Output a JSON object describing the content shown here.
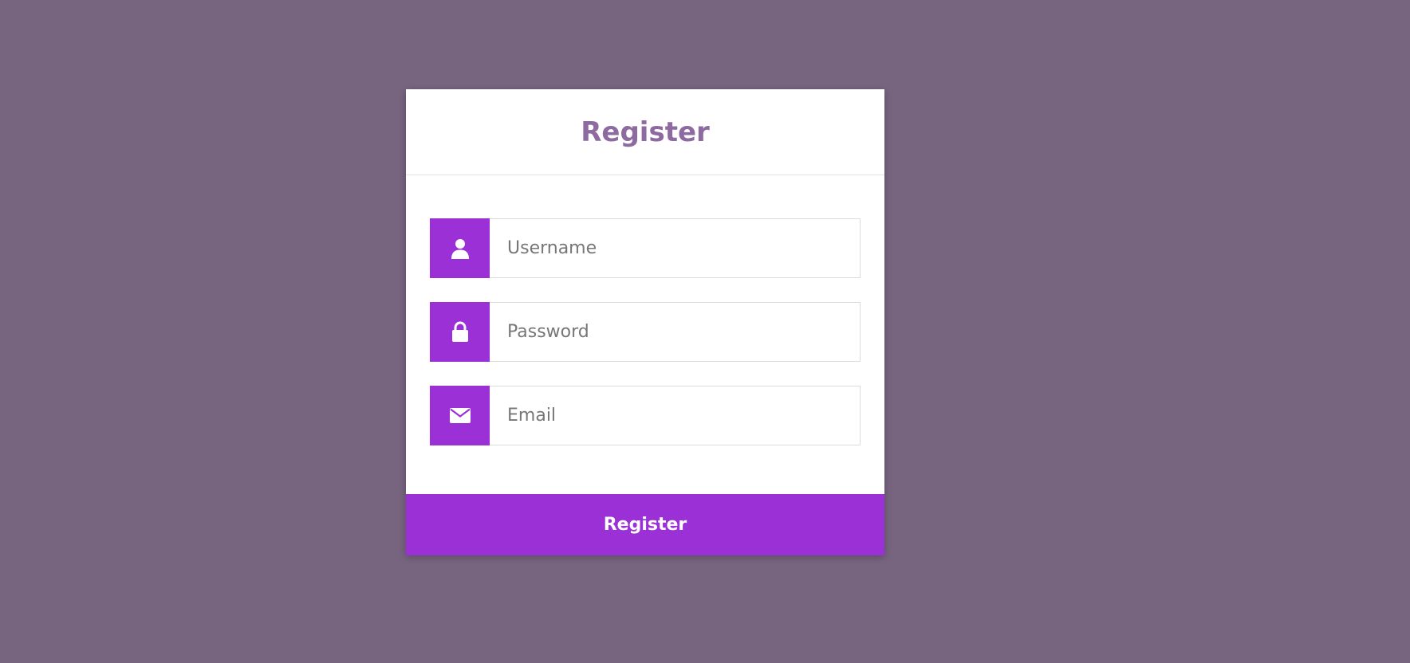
{
  "form": {
    "title": "Register",
    "fields": [
      {
        "icon": "user-icon",
        "placeholder": "Username",
        "value": ""
      },
      {
        "icon": "lock-icon",
        "placeholder": "Password",
        "value": ""
      },
      {
        "icon": "envelope-icon",
        "placeholder": "Email",
        "value": ""
      }
    ],
    "submit_label": "Register"
  },
  "colors": {
    "background": "#77647f",
    "card": "#ffffff",
    "accent": "#9b30d6",
    "title": "#8d6aa0"
  }
}
